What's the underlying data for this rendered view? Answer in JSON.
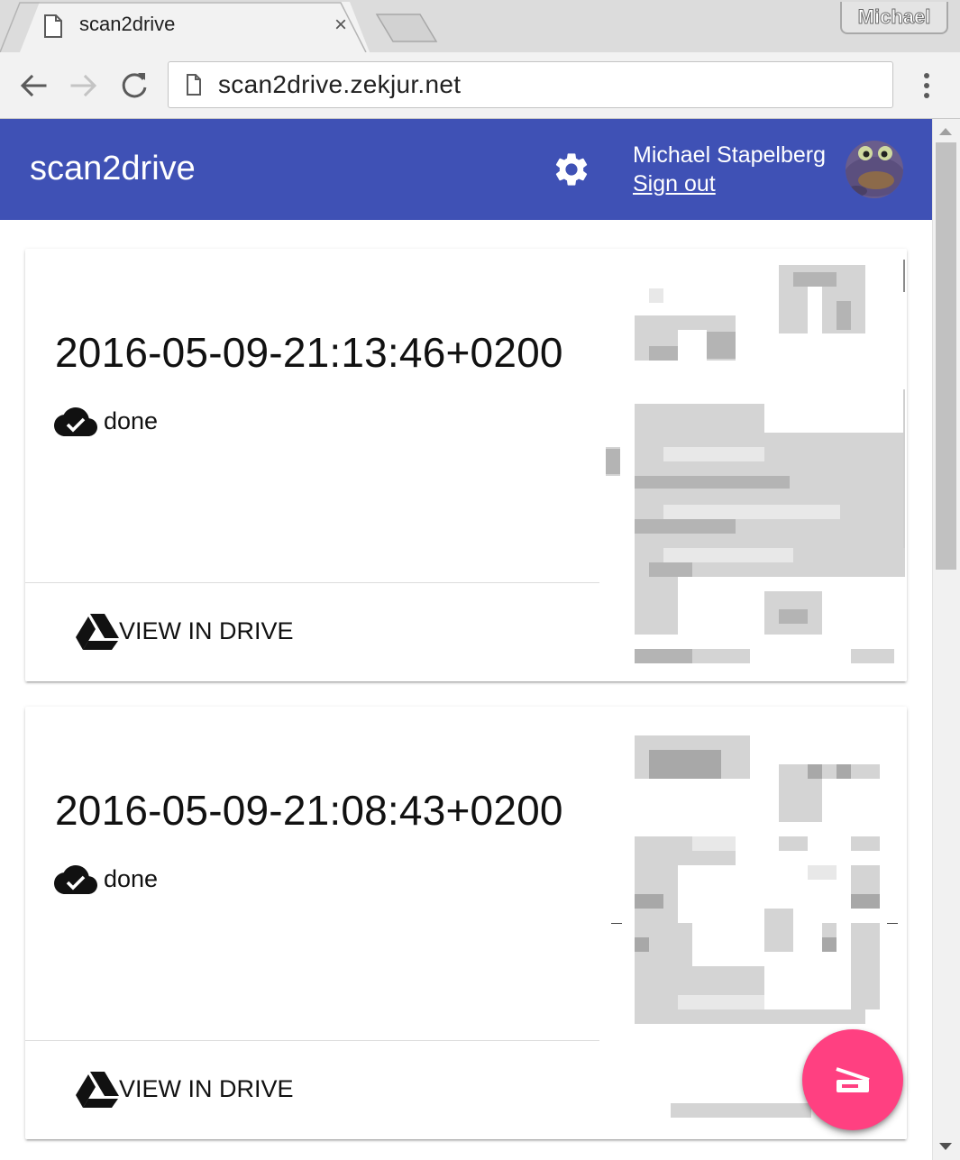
{
  "browser": {
    "tab_title": "scan2drive",
    "tab_close_glyph": "×",
    "profile_name": "Michael",
    "url": "scan2drive.zekjur.net"
  },
  "app": {
    "title": "scan2drive",
    "user_name": "Michael Stapelberg",
    "sign_out_label": "Sign out",
    "accent_color": "#3f51b5",
    "fab_color": "#ff4081"
  },
  "scans": [
    {
      "title": "2016-05-09-21:13:46+0200",
      "status": "done",
      "status_icon": "cloud-done-icon",
      "action_label": "VIEW IN DRIVE",
      "action_icon": "google-drive-icon"
    },
    {
      "title": "2016-05-09-21:08:43+0200",
      "status": "done",
      "status_icon": "cloud-done-icon",
      "action_label": "VIEW IN DRIVE",
      "action_icon": "google-drive-icon"
    }
  ],
  "icons": {
    "settings": "gear-icon",
    "scan_fab": "scanner-icon",
    "back": "back-arrow-icon",
    "forward": "forward-arrow-icon",
    "reload": "reload-icon",
    "menu": "three-dots-menu-icon"
  }
}
